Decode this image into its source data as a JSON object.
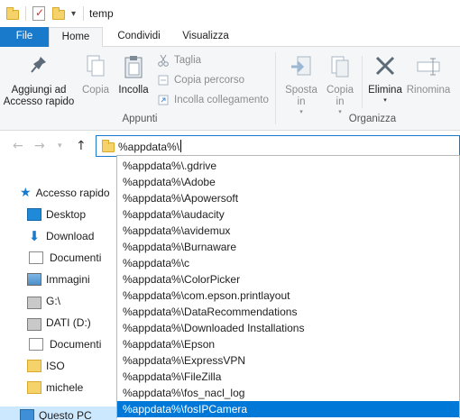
{
  "window": {
    "title": "temp",
    "quick_access_dropdown": "▾"
  },
  "ribbon_tabs": {
    "file": "File",
    "home": "Home",
    "share": "Condividi",
    "view": "Visualizza"
  },
  "ribbon": {
    "clipboard": {
      "pin_label_line1": "Aggiungi ad",
      "pin_label_line2": "Accesso rapido",
      "copy_label": "Copia",
      "paste_label": "Incolla",
      "cut_label": "Taglia",
      "copy_path_label": "Copia percorso",
      "paste_shortcut_label": "Incolla collegamento",
      "group_label": "Appunti"
    },
    "organize": {
      "move_label_line1": "Sposta",
      "move_label_line2": "in",
      "copy_to_label_line1": "Copia",
      "copy_to_label_line2": "in",
      "delete_label": "Elimina",
      "rename_label": "Rinomina",
      "group_label": "Organizza"
    }
  },
  "navigation": {
    "back_icon": "←",
    "forward_icon": "→",
    "dropdown_icon": "▾",
    "up_icon": "↑",
    "address_value": "%appdata%\\"
  },
  "nav_pane": {
    "items": [
      {
        "label": "Accesso rapido",
        "icon": "star-icon"
      },
      {
        "label": "Desktop",
        "icon": "desktop-icon"
      },
      {
        "label": "Download",
        "icon": "download-icon"
      },
      {
        "label": "Documenti",
        "icon": "documents-icon"
      },
      {
        "label": "Immagini",
        "icon": "pictures-icon"
      },
      {
        "label": "G:\\",
        "icon": "drive-icon"
      },
      {
        "label": "DATI (D:)",
        "icon": "drive-icon"
      },
      {
        "label": "Documenti",
        "icon": "documents-icon"
      },
      {
        "label": "ISO",
        "icon": "folder-icon"
      },
      {
        "label": "michele",
        "icon": "folder-icon"
      },
      {
        "label": "Questo PC",
        "icon": "pc-icon"
      }
    ]
  },
  "autocomplete": {
    "items": [
      "%appdata%\\.gdrive",
      "%appdata%\\Adobe",
      "%appdata%\\Apowersoft",
      "%appdata%\\audacity",
      "%appdata%\\avidemux",
      "%appdata%\\Burnaware",
      "%appdata%\\c",
      "%appdata%\\ColorPicker",
      "%appdata%\\com.epson.printlayout",
      "%appdata%\\DataRecommendations",
      "%appdata%\\Downloaded Installations",
      "%appdata%\\Epson",
      "%appdata%\\ExpressVPN",
      "%appdata%\\FileZilla",
      "%appdata%\\fos_nacl_log",
      "%appdata%\\fosIPCamera"
    ],
    "selected_index": 15
  },
  "colors": {
    "accent": "#1979ca",
    "selection": "#0078d7",
    "nav_selection": "#cce8ff",
    "ribbon_bg": "#f5f6f7"
  }
}
